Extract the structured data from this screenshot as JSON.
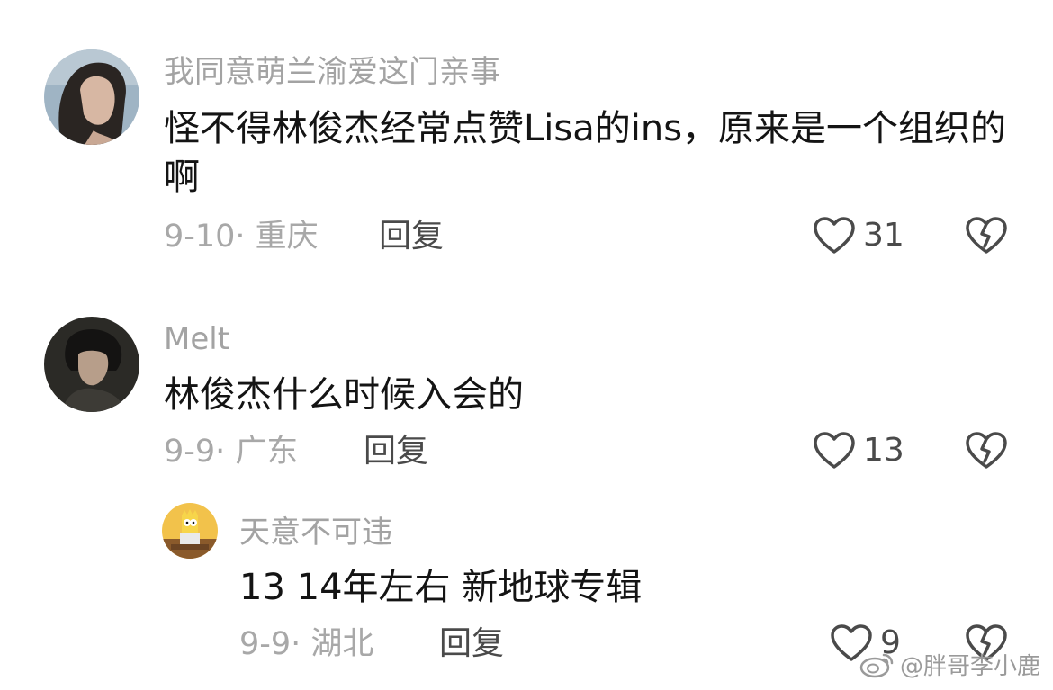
{
  "comments": [
    {
      "username": "我同意萌兰渝爱这门亲事",
      "text": "怪不得林俊杰经常点赞Lisa的ins，原来是一个组织的啊",
      "meta": "9-10· 重庆",
      "reply_label": "回复",
      "likes": "31"
    },
    {
      "username": "Melt",
      "text": "林俊杰什么时候入会的",
      "meta": "9-9· 广东",
      "reply_label": "回复",
      "likes": "13",
      "replies": [
        {
          "username": "天意不可违",
          "text": "13 14年左右 新地球专辑",
          "meta": "9-9· 湖北",
          "reply_label": "回复",
          "likes": "9"
        }
      ]
    }
  ],
  "watermark": "@胖哥李小鹿",
  "colors": {
    "username": "#a3a3a3",
    "text": "#141414",
    "meta": "#a8a8a8",
    "action": "#4a4a4a"
  },
  "icons": [
    "heart-icon",
    "broken-heart-icon",
    "weibo-logo-icon"
  ]
}
